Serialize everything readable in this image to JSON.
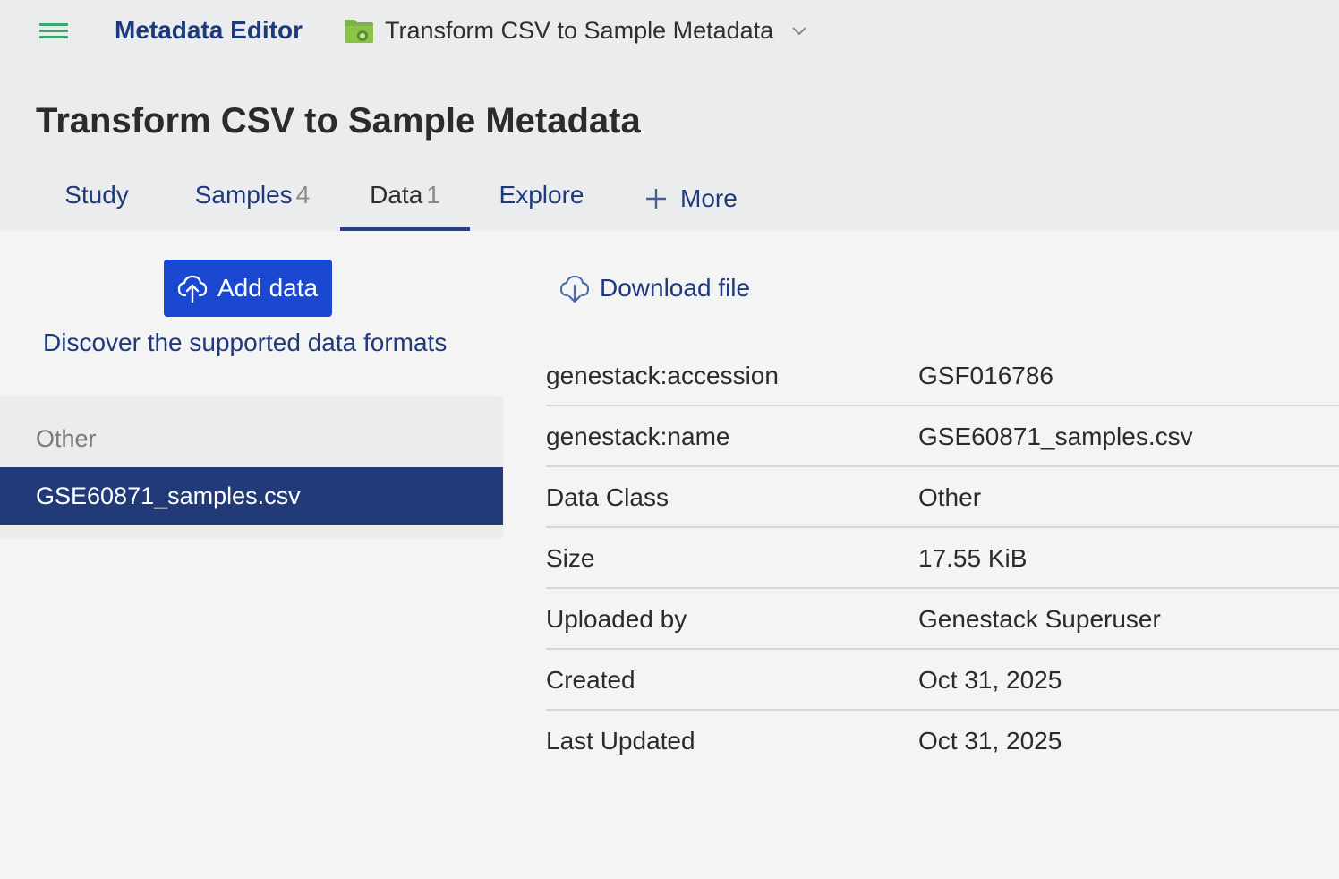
{
  "topbar": {
    "app_title": "Metadata Editor",
    "study_name": "Transform CSV to Sample Metadata",
    "menu_icon": "hamburger-menu-icon",
    "folder_icon": "study-folder-icon",
    "chevron_icon": "chevron-down-icon"
  },
  "page": {
    "title": "Transform CSV to Sample Metadata"
  },
  "tabs": [
    {
      "label": "Study",
      "count": ""
    },
    {
      "label": "Samples",
      "count": "4"
    },
    {
      "label": "Data",
      "count": "1"
    },
    {
      "label": "Explore",
      "count": ""
    },
    {
      "label": "More",
      "count": "",
      "icon": "plus-icon"
    }
  ],
  "active_tab": "Data",
  "left_panel": {
    "add_button_label": "Add data",
    "add_button_icon": "cloud-upload-icon",
    "formats_link": "Discover the supported data formats",
    "group_label": "Other",
    "files": [
      "GSE60871_samples.csv"
    ]
  },
  "right_panel": {
    "download_label": "Download file",
    "download_icon": "cloud-download-icon",
    "metadata": [
      {
        "key": "genestack:accession",
        "value": "GSF016786"
      },
      {
        "key": "genestack:name",
        "value": "GSE60871_samples.csv"
      },
      {
        "key": "Data Class",
        "value": "Other"
      },
      {
        "key": "Size",
        "value": "17.55 KiB"
      },
      {
        "key": "Uploaded by",
        "value": "Genestack Superuser"
      },
      {
        "key": "Created",
        "value": "Oct 31, 2025"
      },
      {
        "key": "Last Updated",
        "value": "Oct 31, 2025"
      }
    ]
  },
  "colors": {
    "accent": "#1a48d1",
    "nav_text": "#1f3a7a",
    "selected_item": "#223b78",
    "menu_icon": "#3aa76d",
    "folder_icon": "#7cb342"
  }
}
